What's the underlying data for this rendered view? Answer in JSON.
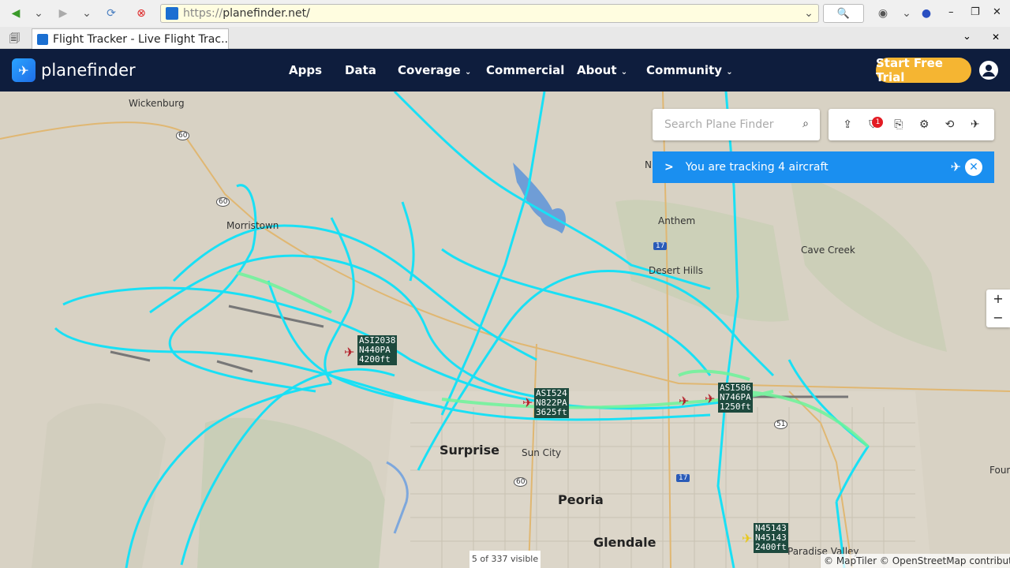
{
  "browser": {
    "url_protocol": "https://",
    "url_host": "planefinder.net/",
    "tab_title": "Flight Tracker - Live Flight Trac..."
  },
  "header": {
    "logo_text_bold": "plane",
    "logo_text": "finder",
    "nav": [
      "Apps",
      "Data",
      "Coverage",
      "Commercial",
      "About",
      "Community"
    ],
    "cta_label": "Start Free Trial"
  },
  "map": {
    "search_placeholder": "Search Plane Finder",
    "alert_badge": "1",
    "tracking_text": "You are tracking 4 aircraft",
    "zoom_in": "+",
    "zoom_out": "−",
    "visible_count": "5 of 337 visible",
    "attribution": "© MapTiler © OpenStreetMap contributors",
    "places": {
      "wickenburg": "Wickenburg",
      "morristown": "Morristown",
      "anthem": "Anthem",
      "desert_hills": "Desert Hills",
      "cave_creek": "Cave Creek",
      "surprise": "Surprise",
      "sun_city": "Sun City",
      "peoria": "Peoria",
      "glendale": "Glendale",
      "paradise_valley": "Paradise Valley",
      "four": "Four",
      "n_partial": "N"
    },
    "roads": [
      "60",
      "60",
      "17",
      "17",
      "51",
      "60"
    ],
    "aircraft": [
      {
        "label": "ASI2038\nN440PA\n4200ft"
      },
      {
        "label": "ASI524\nN822PA\n3625ft"
      },
      {
        "label": "ASI586\nN746PA\n1250ft"
      },
      {
        "label": "N45143\nN45143\n2400ft"
      }
    ]
  },
  "colors": {
    "header_bg": "#0e1d3d",
    "cta": "#f5b532",
    "tracking_bar": "#1a8ff0",
    "track_cyan": "#19e0f5",
    "track_green": "#6cf59a",
    "label_bg": "#1e4a3e"
  }
}
